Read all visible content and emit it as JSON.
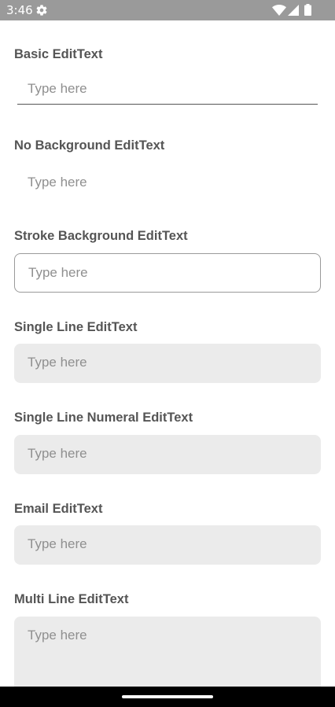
{
  "status_bar": {
    "time": "3:46",
    "icons": [
      "gear-icon",
      "wifi-icon",
      "signal-icon",
      "battery-icon"
    ]
  },
  "sections": [
    {
      "label": "Basic EditText",
      "placeholder": "Type here"
    },
    {
      "label": "No Background EditText",
      "placeholder": "Type here"
    },
    {
      "label": "Stroke Background EditText",
      "placeholder": "Type here"
    },
    {
      "label": "Single Line EditText",
      "placeholder": "Type here"
    },
    {
      "label": "Single Line Numeral EditText",
      "placeholder": "Type here"
    },
    {
      "label": "Email EditText",
      "placeholder": "Type here"
    },
    {
      "label": "Multi Line EditText",
      "placeholder": "Type here"
    }
  ],
  "colors": {
    "status_bar": "#9a9a9a",
    "label_text": "#555555",
    "placeholder_text": "#8f8f8f",
    "field_fill": "#ebebeb",
    "field_stroke": "#9a9a9a",
    "nav_bar": "#000000"
  }
}
